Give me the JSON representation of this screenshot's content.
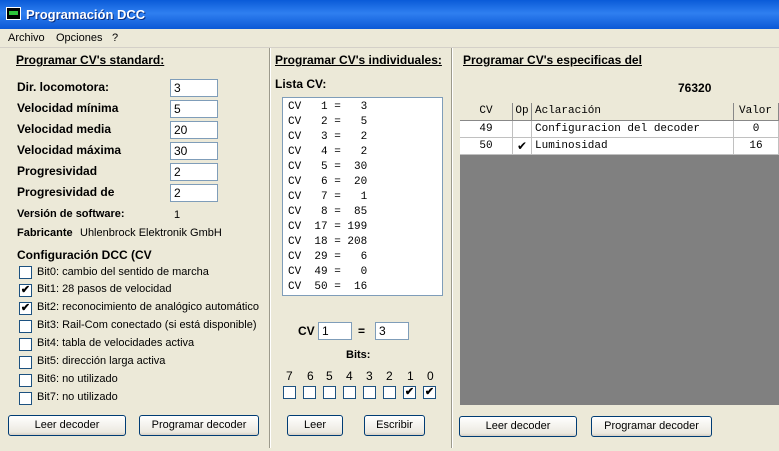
{
  "window": {
    "title": "Programación DCC"
  },
  "menu": [
    "Archivo",
    "Opciones",
    "?"
  ],
  "standard": {
    "heading": "Programar CV's standard:",
    "fields": [
      {
        "label": "Dir. locomotora:",
        "value": "3"
      },
      {
        "label": "Velocidad mínima",
        "value": "5"
      },
      {
        "label": "Velocidad media",
        "value": "20"
      },
      {
        "label": "Velocidad máxima",
        "value": "30"
      },
      {
        "label": "Progresividad",
        "value": "2"
      },
      {
        "label": "Progresividad de",
        "value": "2"
      }
    ],
    "software_label": "Versión de software:",
    "software_value": "1",
    "maker_label": "Fabricante",
    "maker_value": "Uhlenbrock Elektronik GmbH",
    "config_label": "Configuración DCC (CV",
    "bits": [
      {
        "label": "Bit0: cambio del sentido de marcha",
        "checked": false
      },
      {
        "label": "Bit1: 28 pasos de velocidad",
        "checked": true
      },
      {
        "label": "Bit2: reconocimiento de analógico automático",
        "checked": true
      },
      {
        "label": "Bit3: Rail-Com conectado (si está disponible)",
        "checked": false
      },
      {
        "label": "Bit4: tabla de velocidades activa",
        "checked": false
      },
      {
        "label": "Bit5: dirección larga activa",
        "checked": false
      },
      {
        "label": "Bit6: no utilizado",
        "checked": false
      },
      {
        "label": "Bit7: no utilizado",
        "checked": false
      }
    ],
    "read_button": "Leer decoder",
    "program_button": "Programar decoder"
  },
  "individual": {
    "heading": "Programar CV's individuales:",
    "list_label": "Lista CV:",
    "list": [
      "CV   1 =   3",
      "CV   2 =   5",
      "CV   3 =   2",
      "CV   4 =   2",
      "CV   5 =  30",
      "CV   6 =  20",
      "CV   7 =   1",
      "CV   8 =  85",
      "CV  17 = 199",
      "CV  18 = 208",
      "CV  29 =   6",
      "CV  49 =   0",
      "CV  50 =  16"
    ],
    "cv_label": "CV",
    "cv_number": "1",
    "equals": "=",
    "cv_value": "3",
    "bits_label": "Bits:",
    "bit_numbers": [
      "7",
      "6",
      "5",
      "4",
      "3",
      "2",
      "1",
      "0"
    ],
    "bit_checked": [
      false,
      false,
      false,
      false,
      false,
      false,
      true,
      true
    ],
    "read_button": "Leer",
    "write_button": "Escribir"
  },
  "specific": {
    "heading": "Programar CV's especificas del",
    "decoder_id": "76320",
    "columns": [
      "CV",
      "Op",
      "Aclaración",
      "Valor"
    ],
    "rows": [
      {
        "cv": "49",
        "op": "",
        "desc": "Configuracion del decoder",
        "value": "0"
      },
      {
        "cv": "50",
        "op": "✔",
        "desc": "Luminosidad",
        "value": "16"
      }
    ],
    "read_button": "Leer decoder",
    "program_button": "Programar decoder"
  }
}
